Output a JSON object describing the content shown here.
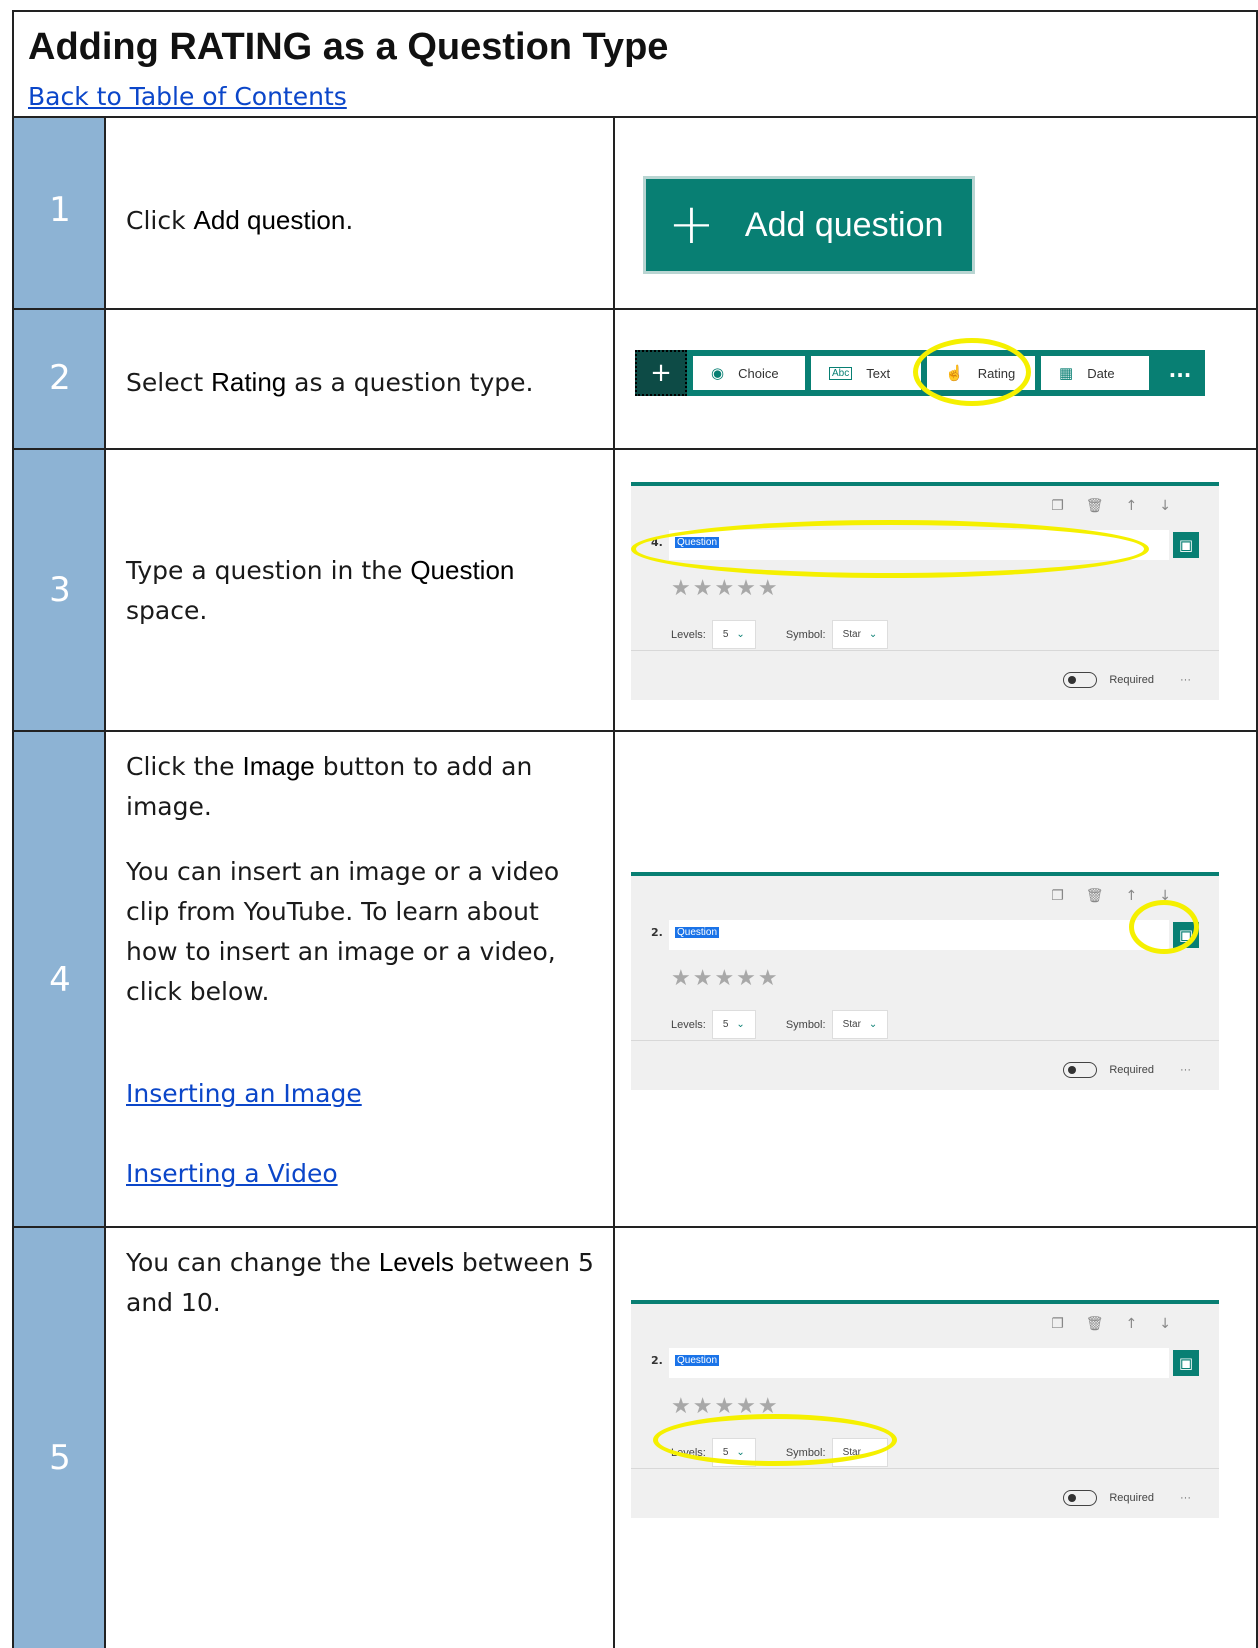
{
  "header": {
    "title": "Adding RATING as a Question Type",
    "back_link": "Back to Table of Contents"
  },
  "steps": [
    {
      "number": "1",
      "pre": "Click ",
      "bold": "Add question",
      "post": "."
    },
    {
      "number": "2",
      "pre": "Select ",
      "bold": "Rating",
      "post": " as a question type."
    },
    {
      "number": "3",
      "pre": "Type a question in the ",
      "bold": "Question",
      "post": " space."
    },
    {
      "number": "4",
      "pre": "Click the ",
      "bold": "Image",
      "post": " button to add an image.",
      "para": "You can insert an image or a video clip from YouTube. To learn about how to insert an image or a video, click below.",
      "link1": "Inserting an Image",
      "link2": "Inserting a Video"
    },
    {
      "number": "5",
      "pre": "You can change the ",
      "bold": "Levels",
      "post": " between 5 and 10."
    }
  ],
  "add_question_button": {
    "label": "Add question",
    "icon": "plus-icon"
  },
  "question_toolbar": {
    "add_icon": "plus-icon",
    "choice": "Choice",
    "text": "Text",
    "rating": "Rating",
    "date": "Date",
    "more": "...",
    "icons": [
      "radio-icon",
      "text-icon",
      "thumbs-up-icon",
      "calendar-icon"
    ]
  },
  "card_step3": {
    "qnum": "4.",
    "question": "Question",
    "levels_label": "Levels:",
    "levels_value": "5",
    "symbol_label": "Symbol:",
    "symbol_value": "Star",
    "required": "Required",
    "more": "···",
    "rating_stars": 5
  },
  "card_step4": {
    "qnum": "2.",
    "question": "Question",
    "levels_label": "Levels:",
    "levels_value": "5",
    "symbol_label": "Symbol:",
    "symbol_value": "Star",
    "required": "Required",
    "more": "···",
    "rating_stars": 5
  },
  "card_step5": {
    "qnum": "2.",
    "question": "Question",
    "levels_label": "Levels:",
    "levels_value": "5",
    "symbol_label": "Symbol:",
    "symbol_value": "Star",
    "required": "Required",
    "more": "···",
    "rating_stars": 5
  },
  "colors": {
    "step_number_bg": "#8db3d4",
    "forms_teal": "#087f73",
    "highlight": "#f5f000",
    "link": "#0b46c9"
  }
}
